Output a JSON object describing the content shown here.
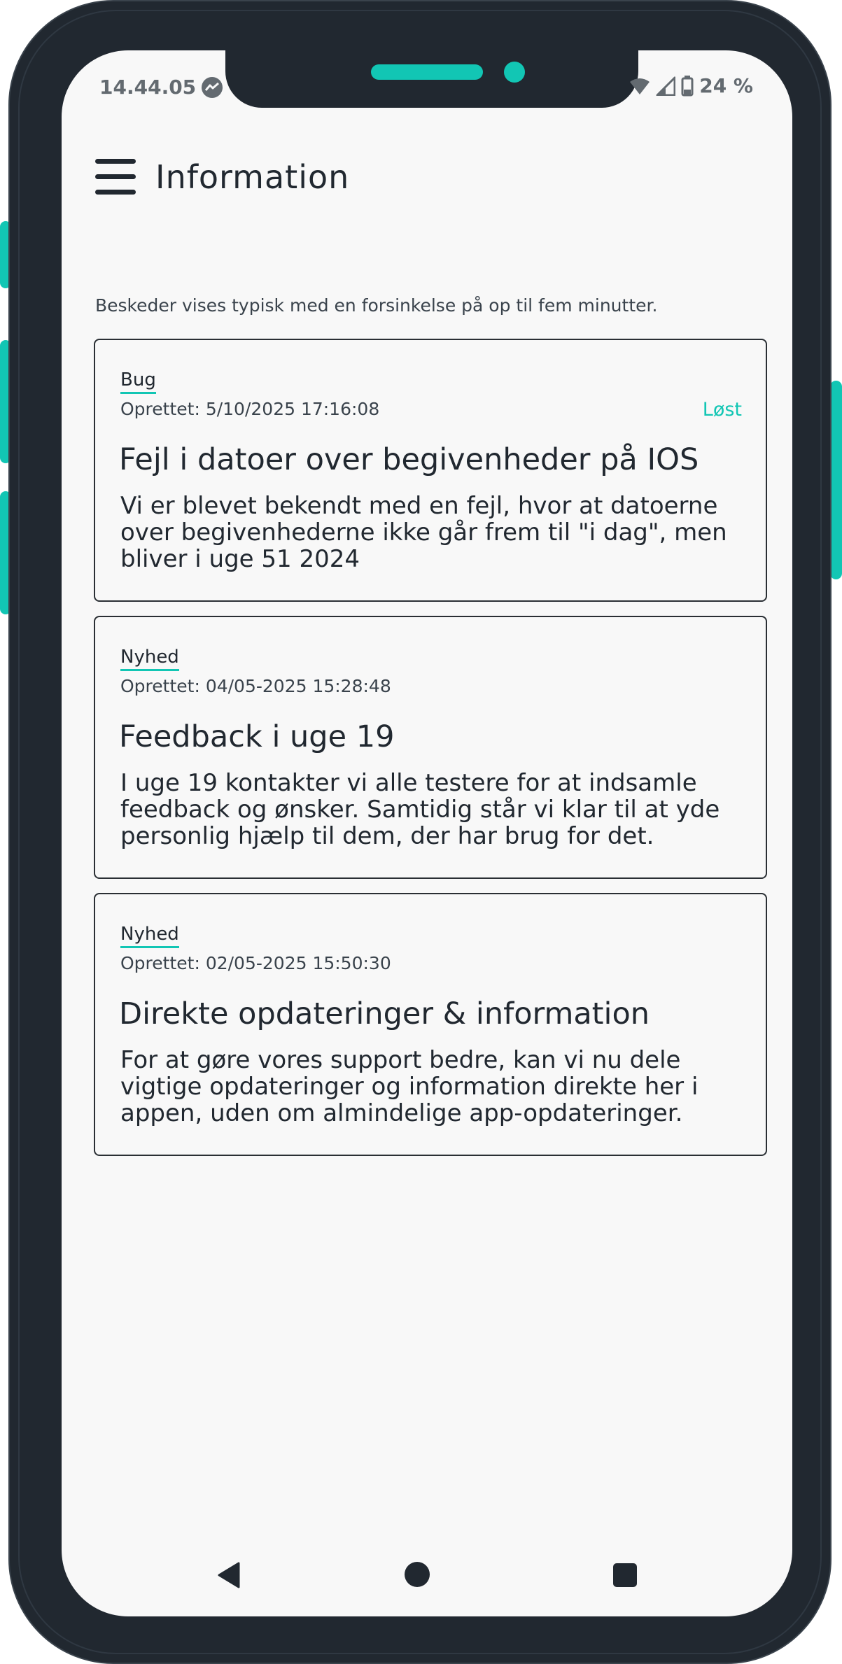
{
  "status_bar": {
    "time": "14.44.05",
    "battery": "24 %"
  },
  "header": {
    "title": "Information"
  },
  "notice": "Beskeder vises typisk med en forsinkelse på op til fem minutter.",
  "messages": [
    {
      "category": "Bug",
      "created": "Oprettet: 5/10/2025 17:16:08",
      "status": "Løst",
      "title": "Fejl i datoer over begivenheder på IOS",
      "body": "Vi er blevet bekendt med en fejl, hvor at datoerne over begivenhederne ikke går frem til \"i dag\", men bliver i uge 51 2024"
    },
    {
      "category": "Nyhed",
      "created": "Oprettet: 04/05-2025 15:28:48",
      "title": "Feedback i uge 19",
      "body": "I uge 19 kontakter vi alle testere for at indsamle feedback og ønsker. Samtidig står vi klar til at yde personlig hjælp til dem, der har brug for det."
    },
    {
      "category": "Nyhed",
      "created": "Oprettet: 02/05-2025 15:50:30",
      "title": "Direkte opdateringer & information",
      "body": "For at gøre vores support bedre, kan vi nu dele vigtige opdateringer og information direkte her i appen, uden om almindelige app-opdateringer."
    }
  ],
  "colors": {
    "accent": "#12c6b4",
    "frame": "#212830",
    "screen_bg": "#f8f8f8"
  }
}
